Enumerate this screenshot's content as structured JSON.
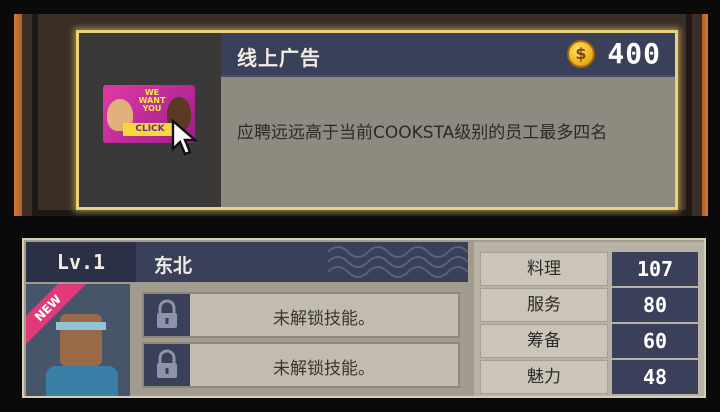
{
  "ad": {
    "title": "线上广告",
    "price": "400",
    "currency_icon": "coin-icon",
    "currency_symbol": "$",
    "description": "应聘远远高于当前COOKSTA级别的员工最多四名",
    "image": {
      "headline": "WE WANT YOU",
      "button": "CLICK"
    }
  },
  "chef": {
    "level": "Lv.1",
    "name": "东北",
    "badge": "NEW",
    "skills": [
      {
        "label": "未解锁技能。",
        "icon": "lock-icon"
      },
      {
        "label": "未解锁技能。",
        "icon": "lock-icon"
      }
    ],
    "stats": [
      {
        "label": "料理",
        "value": "107"
      },
      {
        "label": "服务",
        "value": "80"
      },
      {
        "label": "筹备",
        "value": "60"
      },
      {
        "label": "魅力",
        "value": "48"
      }
    ]
  },
  "colors": {
    "header_navy": "#3a3f5a",
    "highlight_gold": "#e9d27a",
    "frame_orange": "#d27a36",
    "new_pink": "#e23a78"
  }
}
